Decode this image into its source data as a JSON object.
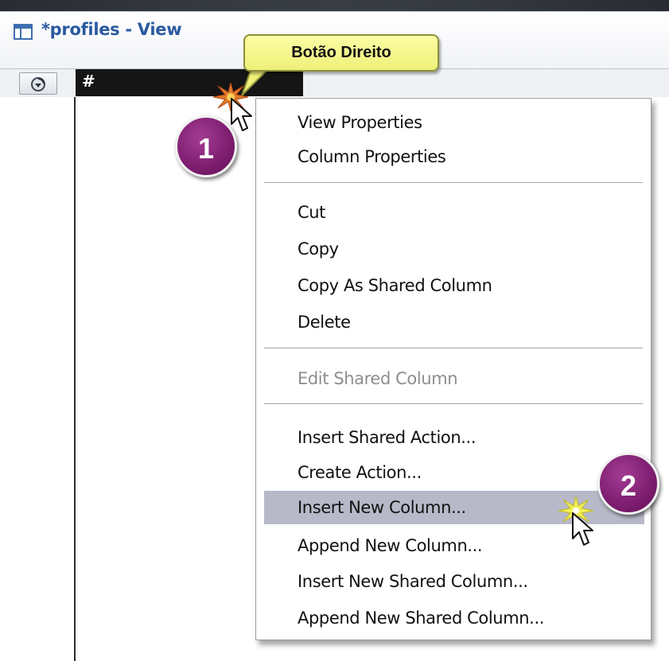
{
  "window": {
    "title": "*profiles - View"
  },
  "view": {
    "column_header": "#"
  },
  "callout": {
    "text": "Botão Direito"
  },
  "badges": {
    "step1": "1",
    "step2": "2"
  },
  "context_menu": {
    "groups": [
      [
        "View Properties",
        "Column Properties"
      ],
      [
        "Cut",
        "Copy",
        "Copy As Shared Column",
        "Delete"
      ],
      [
        "Edit Shared Column"
      ],
      [
        "Insert Shared Action...",
        "Create Action...",
        "Insert New Column...",
        "Append New Column...",
        "Insert New Shared Column...",
        "Append New Shared Column..."
      ]
    ],
    "disabled_item": "Edit Shared Column",
    "highlighted_item": "Insert New Column..."
  },
  "icons": {
    "window": "view-window-icon",
    "refresh": "refresh-icon",
    "cursor": "arrow-cursor-icon",
    "click": "click-burst-icon"
  },
  "colors": {
    "badge": "#7d1d6f",
    "callout": "#f4f68a",
    "menu_highlight": "#b7b9c8",
    "title_text": "#2a5aa0"
  }
}
